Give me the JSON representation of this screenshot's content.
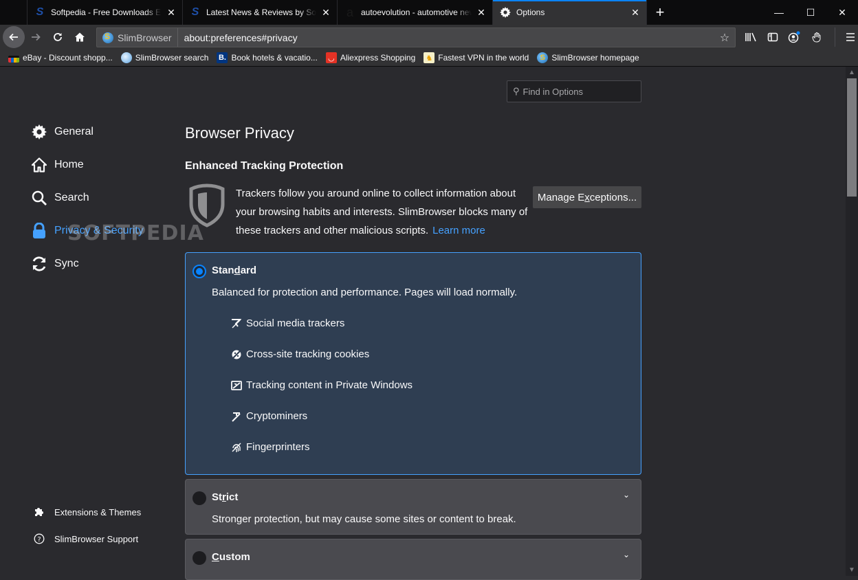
{
  "tabs": [
    {
      "title": "Softpedia - Free Downloads Encyclopedia",
      "favicon": "softpedia-s",
      "active": false
    },
    {
      "title": "Latest News & Reviews by Softpedia",
      "favicon": "softpedia-s",
      "active": false
    },
    {
      "title": "autoevolution - automotive news",
      "favicon": "autoevolution-a",
      "active": false
    },
    {
      "title": "Options",
      "favicon": "gear-icon",
      "active": true
    }
  ],
  "window_controls": {
    "minimize": "—",
    "maximize": "☐",
    "close": "✕"
  },
  "navbar": {
    "identity_label": "SlimBrowser",
    "url": "about:preferences#privacy"
  },
  "bookmarks": [
    {
      "label": "eBay - Discount shopp...",
      "icon": "ebay-icon"
    },
    {
      "label": "SlimBrowser search",
      "icon": "search-globe-icon"
    },
    {
      "label": "Book hotels & vacatio...",
      "icon": "booking-icon"
    },
    {
      "label": "Aliexpress Shopping",
      "icon": "aliexpress-icon"
    },
    {
      "label": "Fastest VPN in the world",
      "icon": "vpn-icon"
    },
    {
      "label": "SlimBrowser homepage",
      "icon": "slimbrowser-icon"
    }
  ],
  "sidebar": {
    "categories": [
      {
        "label": "General",
        "icon": "gear-icon",
        "selected": false
      },
      {
        "label": "Home",
        "icon": "home-icon",
        "selected": false
      },
      {
        "label": "Search",
        "icon": "search-icon",
        "selected": false
      },
      {
        "label": "Privacy & Security",
        "icon": "lock-icon",
        "selected": true
      },
      {
        "label": "Sync",
        "icon": "sync-icon",
        "selected": false
      }
    ],
    "footer": [
      {
        "label": "Extensions & Themes",
        "icon": "puzzle-icon"
      },
      {
        "label": "SlimBrowser Support",
        "icon": "help-icon"
      }
    ]
  },
  "watermark": "SOFTPEDIA",
  "find": {
    "placeholder": "Find in Options"
  },
  "main": {
    "title": "Browser Privacy",
    "etp_heading": "Enhanced Tracking Protection",
    "etp_description": "Trackers follow you around online to collect information about your browsing habits and interests. SlimBrowser blocks many of these trackers and other malicious scripts.",
    "learn_more": "Learn more",
    "manage_exceptions": {
      "pre": "Manage E",
      "accesskey": "x",
      "post": "ceptions..."
    },
    "options": [
      {
        "id": "standard",
        "title_pre": "Stan",
        "title_key": "d",
        "title_post": "ard",
        "description": "Balanced for protection and performance. Pages will load normally.",
        "checked": true,
        "features": [
          {
            "label": "Social media trackers",
            "icon": "social-tracker-icon"
          },
          {
            "label": "Cross-site tracking cookies",
            "icon": "cookie-icon"
          },
          {
            "label": "Tracking content in Private Windows",
            "icon": "tracking-content-icon"
          },
          {
            "label": "Cryptominers",
            "icon": "cryptominer-icon"
          },
          {
            "label": "Fingerprinters",
            "icon": "fingerprint-icon"
          }
        ]
      },
      {
        "id": "strict",
        "title_pre": "St",
        "title_key": "r",
        "title_post": "ict",
        "description": "Stronger protection, but may cause some sites or content to break.",
        "checked": false
      },
      {
        "id": "custom",
        "title_pre": "",
        "title_key": "C",
        "title_post": "ustom",
        "checked": false
      }
    ]
  },
  "colors": {
    "accent": "#0a84ff",
    "link": "#45a1ff",
    "selected_option_bg": "#2f3e52"
  }
}
